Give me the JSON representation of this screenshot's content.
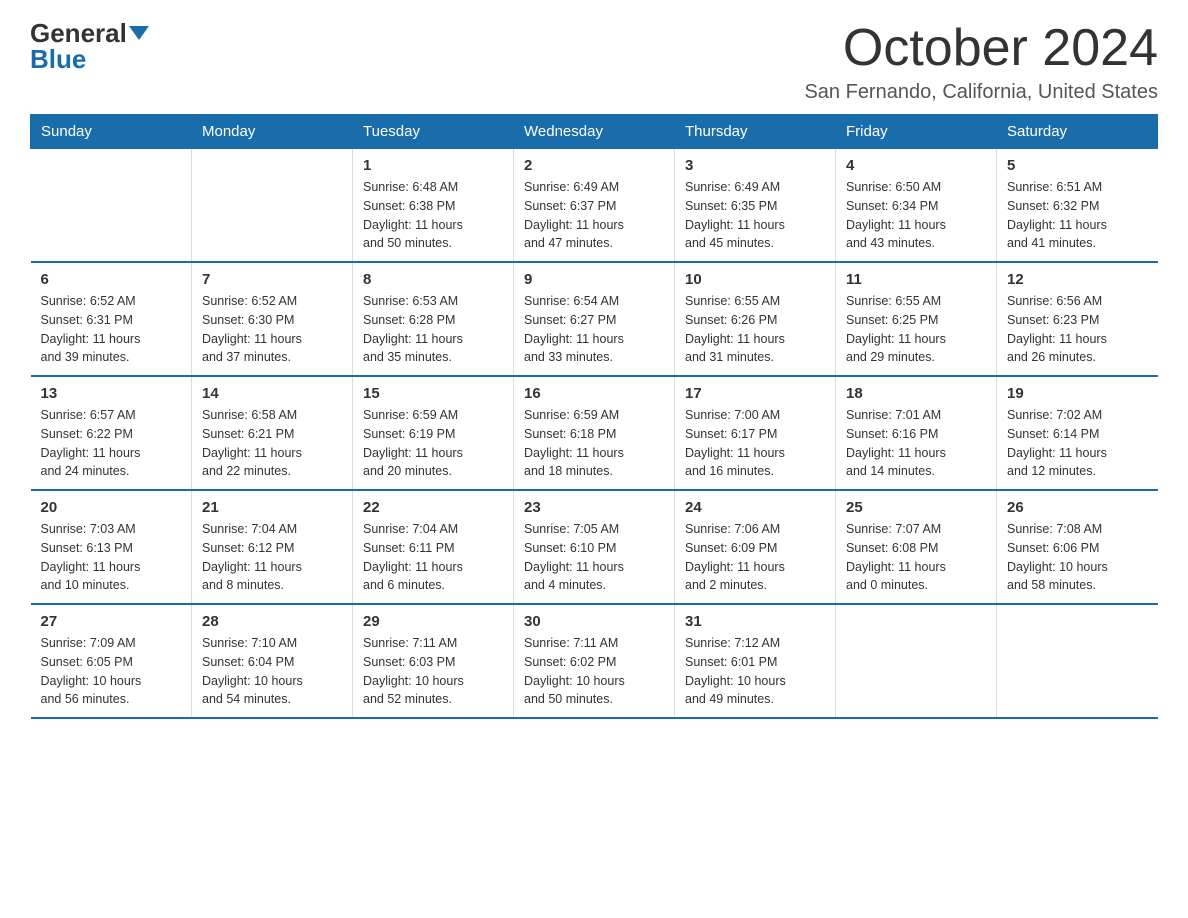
{
  "logo": {
    "general": "General",
    "blue": "Blue"
  },
  "title": "October 2024",
  "location": "San Fernando, California, United States",
  "days_of_week": [
    "Sunday",
    "Monday",
    "Tuesday",
    "Wednesday",
    "Thursday",
    "Friday",
    "Saturday"
  ],
  "weeks": [
    [
      {
        "day": "",
        "info": ""
      },
      {
        "day": "",
        "info": ""
      },
      {
        "day": "1",
        "info": "Sunrise: 6:48 AM\nSunset: 6:38 PM\nDaylight: 11 hours\nand 50 minutes."
      },
      {
        "day": "2",
        "info": "Sunrise: 6:49 AM\nSunset: 6:37 PM\nDaylight: 11 hours\nand 47 minutes."
      },
      {
        "day": "3",
        "info": "Sunrise: 6:49 AM\nSunset: 6:35 PM\nDaylight: 11 hours\nand 45 minutes."
      },
      {
        "day": "4",
        "info": "Sunrise: 6:50 AM\nSunset: 6:34 PM\nDaylight: 11 hours\nand 43 minutes."
      },
      {
        "day": "5",
        "info": "Sunrise: 6:51 AM\nSunset: 6:32 PM\nDaylight: 11 hours\nand 41 minutes."
      }
    ],
    [
      {
        "day": "6",
        "info": "Sunrise: 6:52 AM\nSunset: 6:31 PM\nDaylight: 11 hours\nand 39 minutes."
      },
      {
        "day": "7",
        "info": "Sunrise: 6:52 AM\nSunset: 6:30 PM\nDaylight: 11 hours\nand 37 minutes."
      },
      {
        "day": "8",
        "info": "Sunrise: 6:53 AM\nSunset: 6:28 PM\nDaylight: 11 hours\nand 35 minutes."
      },
      {
        "day": "9",
        "info": "Sunrise: 6:54 AM\nSunset: 6:27 PM\nDaylight: 11 hours\nand 33 minutes."
      },
      {
        "day": "10",
        "info": "Sunrise: 6:55 AM\nSunset: 6:26 PM\nDaylight: 11 hours\nand 31 minutes."
      },
      {
        "day": "11",
        "info": "Sunrise: 6:55 AM\nSunset: 6:25 PM\nDaylight: 11 hours\nand 29 minutes."
      },
      {
        "day": "12",
        "info": "Sunrise: 6:56 AM\nSunset: 6:23 PM\nDaylight: 11 hours\nand 26 minutes."
      }
    ],
    [
      {
        "day": "13",
        "info": "Sunrise: 6:57 AM\nSunset: 6:22 PM\nDaylight: 11 hours\nand 24 minutes."
      },
      {
        "day": "14",
        "info": "Sunrise: 6:58 AM\nSunset: 6:21 PM\nDaylight: 11 hours\nand 22 minutes."
      },
      {
        "day": "15",
        "info": "Sunrise: 6:59 AM\nSunset: 6:19 PM\nDaylight: 11 hours\nand 20 minutes."
      },
      {
        "day": "16",
        "info": "Sunrise: 6:59 AM\nSunset: 6:18 PM\nDaylight: 11 hours\nand 18 minutes."
      },
      {
        "day": "17",
        "info": "Sunrise: 7:00 AM\nSunset: 6:17 PM\nDaylight: 11 hours\nand 16 minutes."
      },
      {
        "day": "18",
        "info": "Sunrise: 7:01 AM\nSunset: 6:16 PM\nDaylight: 11 hours\nand 14 minutes."
      },
      {
        "day": "19",
        "info": "Sunrise: 7:02 AM\nSunset: 6:14 PM\nDaylight: 11 hours\nand 12 minutes."
      }
    ],
    [
      {
        "day": "20",
        "info": "Sunrise: 7:03 AM\nSunset: 6:13 PM\nDaylight: 11 hours\nand 10 minutes."
      },
      {
        "day": "21",
        "info": "Sunrise: 7:04 AM\nSunset: 6:12 PM\nDaylight: 11 hours\nand 8 minutes."
      },
      {
        "day": "22",
        "info": "Sunrise: 7:04 AM\nSunset: 6:11 PM\nDaylight: 11 hours\nand 6 minutes."
      },
      {
        "day": "23",
        "info": "Sunrise: 7:05 AM\nSunset: 6:10 PM\nDaylight: 11 hours\nand 4 minutes."
      },
      {
        "day": "24",
        "info": "Sunrise: 7:06 AM\nSunset: 6:09 PM\nDaylight: 11 hours\nand 2 minutes."
      },
      {
        "day": "25",
        "info": "Sunrise: 7:07 AM\nSunset: 6:08 PM\nDaylight: 11 hours\nand 0 minutes."
      },
      {
        "day": "26",
        "info": "Sunrise: 7:08 AM\nSunset: 6:06 PM\nDaylight: 10 hours\nand 58 minutes."
      }
    ],
    [
      {
        "day": "27",
        "info": "Sunrise: 7:09 AM\nSunset: 6:05 PM\nDaylight: 10 hours\nand 56 minutes."
      },
      {
        "day": "28",
        "info": "Sunrise: 7:10 AM\nSunset: 6:04 PM\nDaylight: 10 hours\nand 54 minutes."
      },
      {
        "day": "29",
        "info": "Sunrise: 7:11 AM\nSunset: 6:03 PM\nDaylight: 10 hours\nand 52 minutes."
      },
      {
        "day": "30",
        "info": "Sunrise: 7:11 AM\nSunset: 6:02 PM\nDaylight: 10 hours\nand 50 minutes."
      },
      {
        "day": "31",
        "info": "Sunrise: 7:12 AM\nSunset: 6:01 PM\nDaylight: 10 hours\nand 49 minutes."
      },
      {
        "day": "",
        "info": ""
      },
      {
        "day": "",
        "info": ""
      }
    ]
  ]
}
